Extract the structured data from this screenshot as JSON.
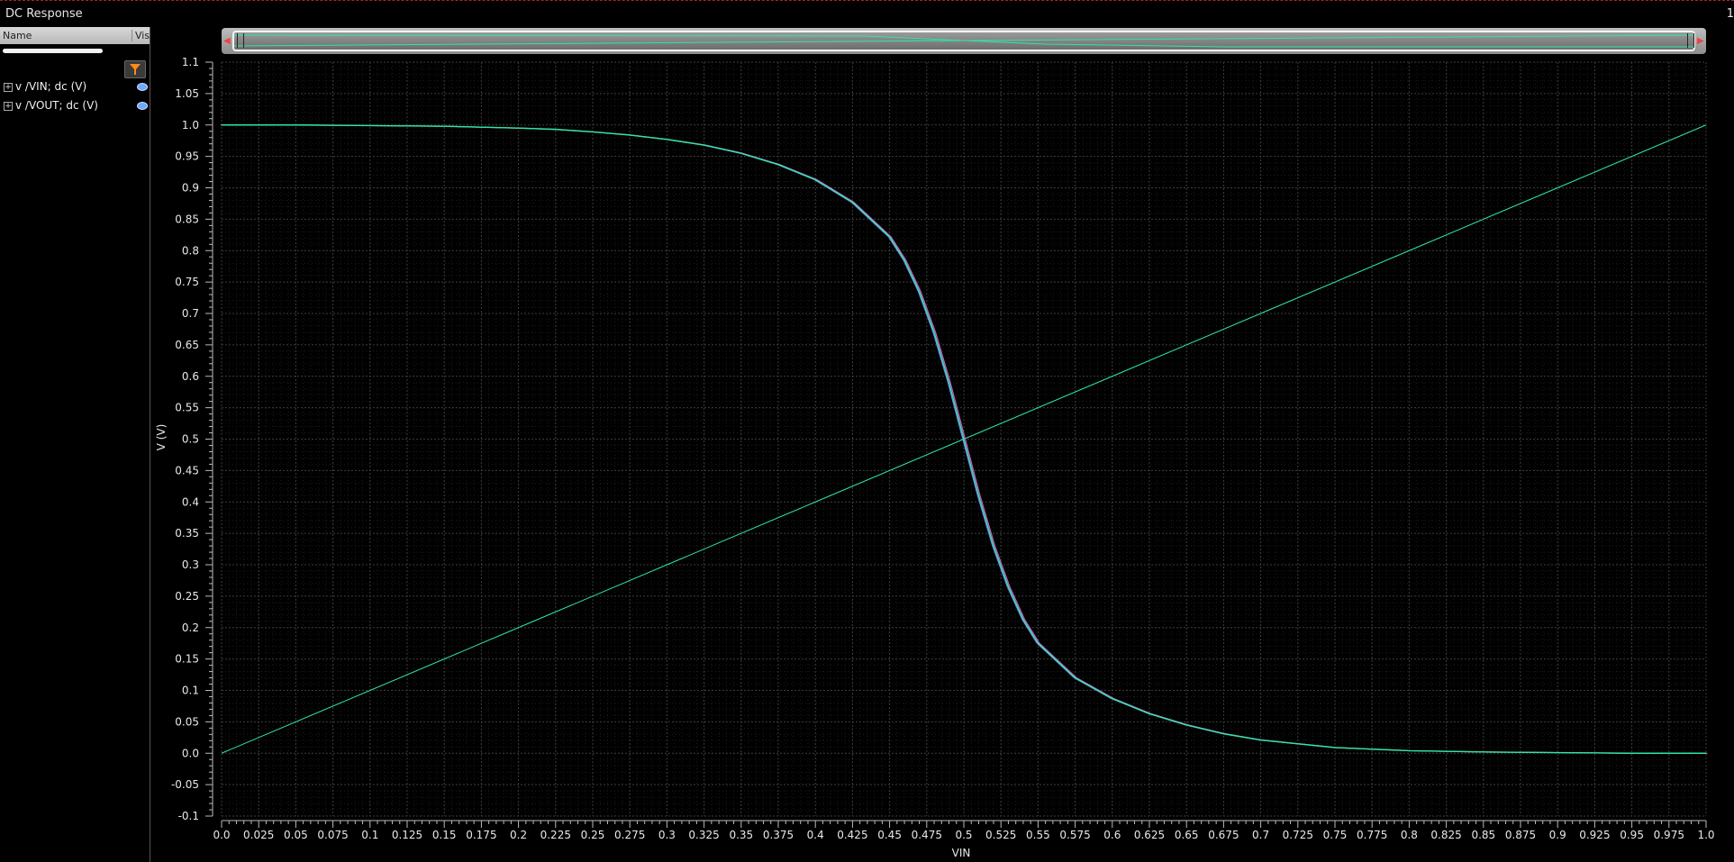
{
  "window": {
    "title": "DC Response",
    "corner_number": "1"
  },
  "legend_panel": {
    "column_name": "Name",
    "column_vis": "Vis",
    "signals": [
      {
        "label": "v /VIN; dc (V)",
        "color": "#2ee6a8"
      },
      {
        "label": "v /VOUT; dc (V)",
        "color": "#2ee6a8"
      }
    ]
  },
  "icons": {
    "filter": "filter-icon",
    "visibility": "eye-icon",
    "expand": "plus-box-icon"
  },
  "colors": {
    "background": "#000000",
    "grid": "#3c3c3c",
    "trace": "#2ee6a8",
    "trace_alt": "#d65cc8",
    "axis_text": "#e8e8e8"
  },
  "chart_data": {
    "type": "line",
    "title": "",
    "xlabel": "VIN",
    "ylabel": "V (V)",
    "xlim": [
      0.0,
      1.0
    ],
    "ylim": [
      -0.1,
      1.1
    ],
    "grid": true,
    "x_ticks": [
      "0.0",
      "0.025",
      "0.05",
      "0.075",
      "0.1",
      "0.125",
      "0.15",
      "0.175",
      "0.2",
      "0.225",
      "0.25",
      "0.275",
      "0.3",
      "0.325",
      "0.35",
      "0.375",
      "0.4",
      "0.425",
      "0.45",
      "0.475",
      "0.5",
      "0.525",
      "0.55",
      "0.575",
      "0.6",
      "0.625",
      "0.65",
      "0.675",
      "0.7",
      "0.725",
      "0.75",
      "0.775",
      "0.8",
      "0.825",
      "0.85",
      "0.875",
      "0.9",
      "0.925",
      "0.95",
      "0.975",
      "1.0"
    ],
    "y_ticks": [
      "1.1",
      "1.05",
      "1.0",
      "0.95",
      "0.9",
      "0.85",
      "0.8",
      "0.75",
      "0.7",
      "0.65",
      "0.6",
      "0.55",
      "0.5",
      "0.45",
      "0.4",
      "0.35",
      "0.3",
      "0.25",
      "0.2",
      "0.15",
      "0.1",
      "0.05",
      "0.0",
      "-0.05",
      "-0.1"
    ],
    "series": [
      {
        "name": "v /VIN; dc (V)",
        "x": [
          0.0,
          0.1,
          0.2,
          0.3,
          0.4,
          0.5,
          0.6,
          0.7,
          0.8,
          0.9,
          1.0
        ],
        "values": [
          0.0,
          0.1,
          0.2,
          0.3,
          0.4,
          0.5,
          0.6,
          0.7,
          0.8,
          0.9,
          1.0
        ]
      },
      {
        "name": "v /VOUT; dc (V)",
        "x": [
          0.0,
          0.05,
          0.1,
          0.15,
          0.2,
          0.225,
          0.25,
          0.275,
          0.3,
          0.325,
          0.35,
          0.375,
          0.4,
          0.425,
          0.45,
          0.46,
          0.47,
          0.48,
          0.49,
          0.5,
          0.51,
          0.52,
          0.53,
          0.54,
          0.55,
          0.575,
          0.6,
          0.625,
          0.65,
          0.675,
          0.7,
          0.75,
          0.8,
          0.85,
          0.9,
          0.95,
          1.0
        ],
        "values": [
          1.0,
          1.0,
          0.999,
          0.998,
          0.995,
          0.993,
          0.989,
          0.984,
          0.977,
          0.968,
          0.955,
          0.937,
          0.913,
          0.877,
          0.822,
          0.785,
          0.735,
          0.67,
          0.59,
          0.5,
          0.41,
          0.33,
          0.265,
          0.213,
          0.175,
          0.12,
          0.087,
          0.063,
          0.045,
          0.031,
          0.021,
          0.009,
          0.004,
          0.002,
          0.001,
          0.0,
          0.0
        ]
      }
    ]
  }
}
